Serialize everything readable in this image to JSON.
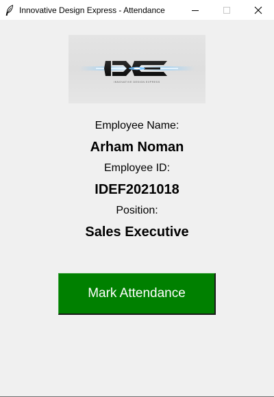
{
  "window": {
    "title": "Innovative Design Express - Attendance",
    "app_icon": "feather-icon",
    "controls": [
      "minimize-icon",
      "maximize-icon",
      "close-icon"
    ]
  },
  "logo": {
    "caption": "INNOVATIVE DESIGN EXPRESS",
    "mark_text": "IDE"
  },
  "employee": {
    "name_label": "Employee Name:",
    "name": "Arham Noman",
    "id_label": "Employee ID:",
    "id": "IDEF2021018",
    "position_label": "Position:",
    "position": "Sales Executive"
  },
  "actions": {
    "mark_attendance_label": "Mark Attendance"
  },
  "colors": {
    "window_bg": "#f0f0f0",
    "button_bg": "#008000",
    "button_text": "#ffffff"
  }
}
